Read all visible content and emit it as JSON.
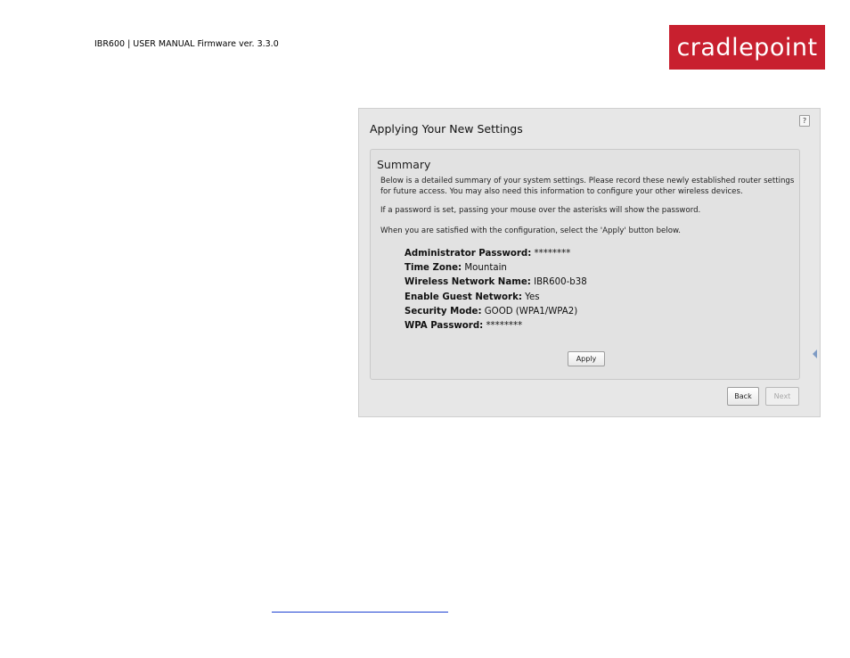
{
  "header": {
    "text": "IBR600 | USER MANUAL Firmware ver. 3.3.0"
  },
  "logo": {
    "text": "cradlepoint",
    "color": "#c8202f"
  },
  "screenshot": {
    "title": "Applying Your New Settings",
    "help_label": "?",
    "panel": {
      "title": "Summary",
      "paragraphs": [
        "Below is a detailed summary of your system settings. Please record these newly established router settings for future access. You may also need this information to configure your other wireless devices.",
        "If a password is set, passing your mouse over the asterisks will show the password.",
        "When you are satisfied with the configuration, select the 'Apply' button below."
      ],
      "settings": [
        {
          "label": "Administrator Password:",
          "value": "********"
        },
        {
          "label": "Time Zone:",
          "value": "Mountain"
        },
        {
          "label": "Wireless Network Name:",
          "value": "IBR600-b38"
        },
        {
          "label": "Enable Guest Network:",
          "value": "Yes"
        },
        {
          "label": "Security Mode:",
          "value": "GOOD (WPA1/WPA2)"
        },
        {
          "label": "WPA Password:",
          "value": "********"
        }
      ],
      "apply_label": "Apply"
    },
    "back_label": "Back",
    "next_label": "Next"
  }
}
